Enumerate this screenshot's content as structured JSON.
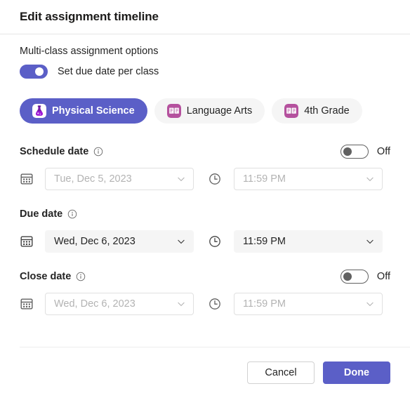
{
  "header": {
    "title": "Edit assignment timeline"
  },
  "multi_class": {
    "section_label": "Multi-class assignment options",
    "toggle_label": "Set due date per class",
    "toggle_state": "on"
  },
  "class_tabs": [
    {
      "label": "Physical Science",
      "icon": "flask-icon",
      "selected": true
    },
    {
      "label": "Language Arts",
      "icon": "book-icon",
      "selected": false
    },
    {
      "label": "4th Grade",
      "icon": "book-icon",
      "selected": false
    }
  ],
  "date_sections": [
    {
      "label": "Schedule date",
      "info_icon": "info-icon",
      "toggle_state": "off",
      "toggle_text": "Off",
      "has_toggle": true,
      "enabled": false,
      "date_icon": "calendar-icon",
      "date_value": "Tue, Dec 5, 2023",
      "time_icon": "clock-icon",
      "time_value": "11:59 PM"
    },
    {
      "label": "Due date",
      "info_icon": "info-icon",
      "toggle_state": "",
      "toggle_text": "",
      "has_toggle": false,
      "enabled": true,
      "date_icon": "calendar-icon",
      "date_value": "Wed, Dec 6, 2023",
      "time_icon": "clock-icon",
      "time_value": "11:59 PM"
    },
    {
      "label": "Close date",
      "info_icon": "info-icon",
      "toggle_state": "off",
      "toggle_text": "Off",
      "has_toggle": true,
      "enabled": false,
      "date_icon": "calendar-icon",
      "date_value": "Wed, Dec 6, 2023",
      "time_icon": "clock-icon",
      "time_value": "11:59 PM"
    }
  ],
  "footer": {
    "cancel_label": "Cancel",
    "done_label": "Done"
  },
  "colors": {
    "accent": "#5b5fc7",
    "field_fill": "#f5f5f5",
    "text": "#242424",
    "placeholder": "#b3b3b3",
    "book_icon": "#b5519e",
    "flask_icon": "#7719aa"
  }
}
